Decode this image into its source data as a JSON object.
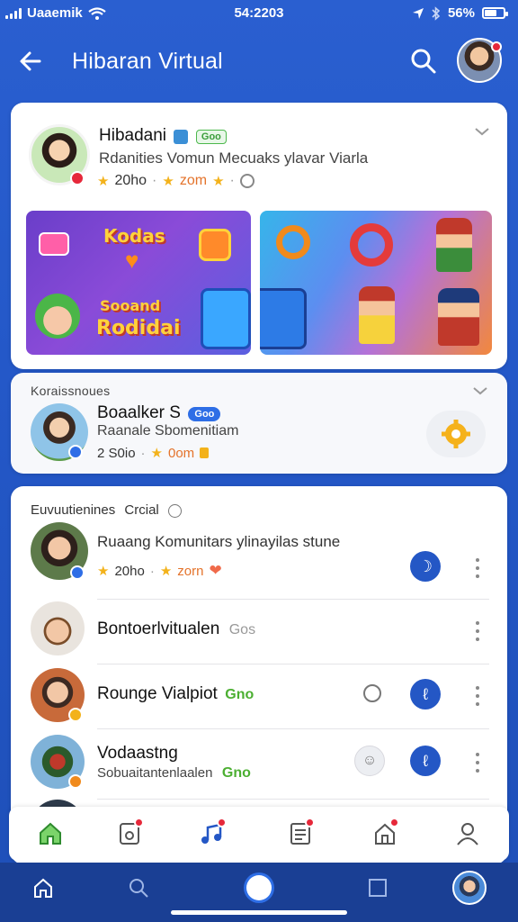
{
  "status_bar": {
    "carrier": "Uaaemik",
    "time": "54:2203",
    "battery": "56%"
  },
  "app_bar": {
    "title": "Hibaran Virtual"
  },
  "featured": {
    "name": "Hibadani",
    "pill": "Goo",
    "description": "Rdanities Vomun Mecuaks ylavar Viarla",
    "stat1": "20ho",
    "stat2": "zom",
    "promo_left_line1": "Kodas",
    "promo_left_line2": "Sooand",
    "promo_left_line3": "Rodidai"
  },
  "section2": {
    "heading": "Koraissnoues",
    "name": "Boaalker S",
    "pill": "Goo",
    "description": "Raanale Sbomenitiam",
    "stat1": "2 S0io",
    "stat2": "0om"
  },
  "section3": {
    "heading": "Euvuutienines",
    "heading_tag": "Crcial",
    "items": [
      {
        "name": "Ruaang Komunitars ylinayilas stune",
        "stat1": "20ho",
        "stat2": "zorn"
      },
      {
        "name": "Bontoerlvitualen",
        "tag": "Gos"
      },
      {
        "name": "Rounge Vialpiot",
        "tag": "Gno"
      },
      {
        "name": "Vodaastng",
        "sub": "Sobuaitantenlaalen",
        "tag": "Gno"
      }
    ]
  },
  "colors": {
    "primary": "#2458c8",
    "accent_green": "#4cb84c",
    "badge_red": "#e6283a"
  }
}
